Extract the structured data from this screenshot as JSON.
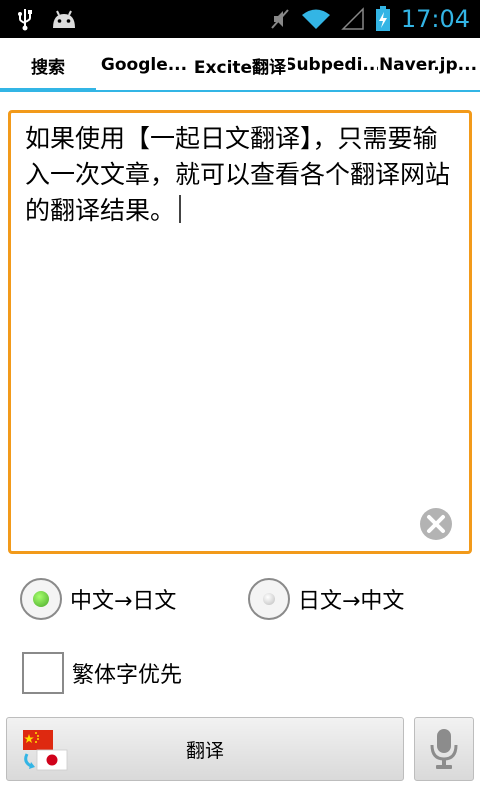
{
  "status_bar": {
    "time": "17:04",
    "icons": [
      "usb-icon",
      "android-icon",
      "mute-icon",
      "wifi-icon",
      "signal-icon",
      "battery-charging-icon"
    ]
  },
  "tabs": [
    {
      "label": "搜索",
      "active": true
    },
    {
      "label": "Google...",
      "active": false
    },
    {
      "label": "Excite翻译",
      "active": false
    },
    {
      "label": "Subpedi...",
      "active": false
    },
    {
      "label": "Naver.jp...",
      "active": false
    }
  ],
  "input": {
    "value": "如果使用【一起日文翻译】，只需要输入一次文章，就可以查看各个翻译网站的翻译结果。"
  },
  "direction": {
    "options": [
      {
        "label": "中文→日文",
        "selected": true
      },
      {
        "label": "日文→中文",
        "selected": false
      }
    ]
  },
  "traditional_first": {
    "label": "繁体字优先",
    "checked": false
  },
  "translate_button": {
    "label": "翻译"
  },
  "colors": {
    "accent": "#33b5e5",
    "input_border": "#f29a1a",
    "radio_selected": "#6cc33d"
  }
}
